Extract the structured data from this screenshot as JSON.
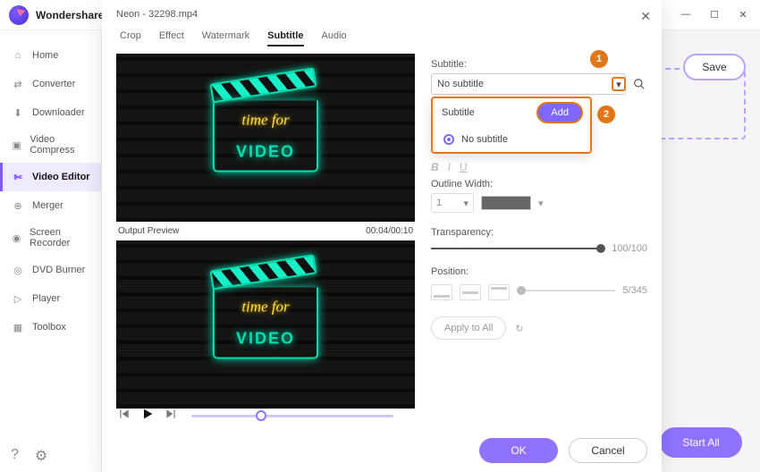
{
  "app": {
    "brand": "Wondershare"
  },
  "window": {
    "menu": "≡",
    "min": "—",
    "max": "☐",
    "close": "✕"
  },
  "sidebar": {
    "items": [
      {
        "label": "Home"
      },
      {
        "label": "Converter"
      },
      {
        "label": "Downloader"
      },
      {
        "label": "Video Compress"
      },
      {
        "label": "Video Editor"
      },
      {
        "label": "Merger"
      },
      {
        "label": "Screen Recorder"
      },
      {
        "label": "DVD Burner"
      },
      {
        "label": "Player"
      },
      {
        "label": "Toolbox"
      }
    ]
  },
  "main": {
    "save_label": "Save",
    "start_all": "Start All"
  },
  "modal": {
    "title": "Neon - 32298.mp4",
    "tabs": [
      "Crop",
      "Effect",
      "Watermark",
      "Subtitle",
      "Audio"
    ],
    "active_tab": 3,
    "output_preview_label": "Output Preview",
    "time": "00:04/00:10",
    "neon": {
      "line1": "time for",
      "line2": "VIDEO"
    },
    "subtitle": {
      "label": "Subtitle:",
      "selected": "No subtitle",
      "dropdown_header": "Subtitle",
      "add_label": "Add",
      "options": [
        "No subtitle"
      ]
    },
    "outline": {
      "label": "Outline Width:",
      "width": "1"
    },
    "transparency": {
      "label": "Transparency:",
      "value": "100/100"
    },
    "position": {
      "label": "Position:",
      "value": "5/345"
    },
    "apply_all": "Apply to All",
    "ok": "OK",
    "cancel": "Cancel",
    "callouts": {
      "one": "1",
      "two": "2"
    }
  }
}
